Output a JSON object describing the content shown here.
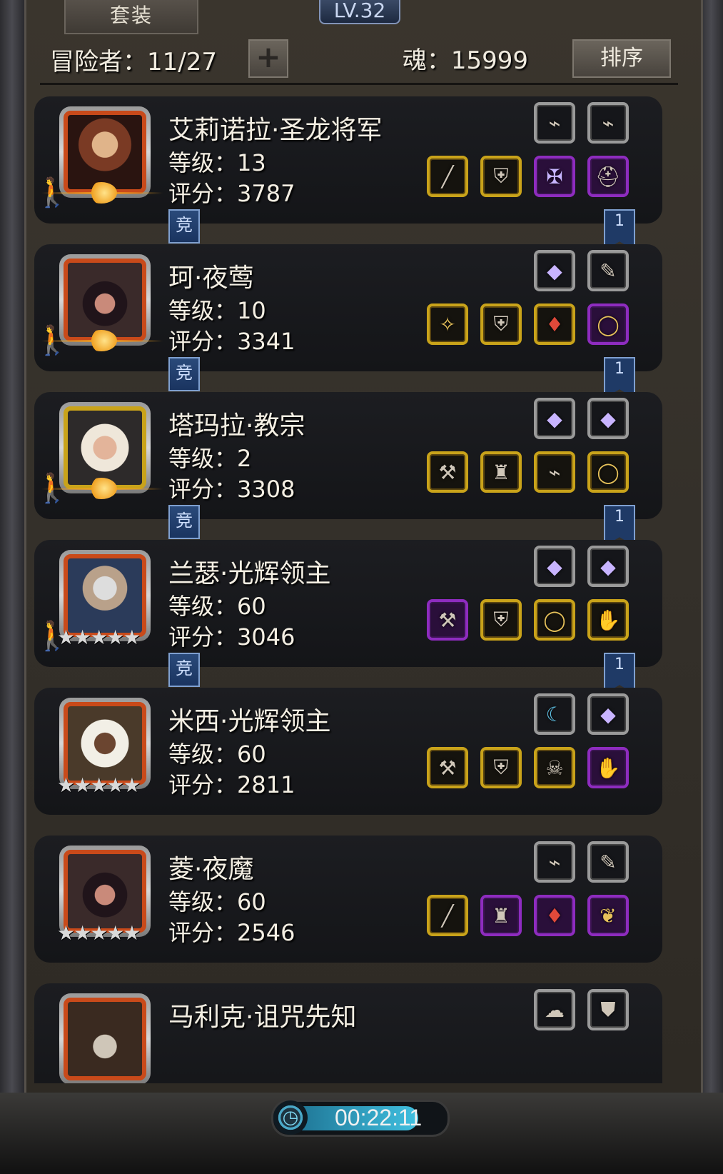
{
  "top_tab": "套装",
  "player_level": "LV.32",
  "header": {
    "adventurer_label": "冒险者：11/27",
    "add_symbol": "+",
    "soul_label": "魂：15999",
    "sort_label": "排序"
  },
  "compete_label": "竞",
  "ribbon_label": "1",
  "cards": [
    {
      "name": "艾莉诺拉·圣龙将军",
      "level": "等级：13",
      "score": "评分：3787",
      "badge": "moon",
      "has_compete": true,
      "has_ribbon": true,
      "top_slots": [
        {
          "frame": "gray",
          "icon": "bracer"
        },
        {
          "frame": "gray",
          "icon": "bracer"
        }
      ],
      "bottom_slots": [
        {
          "frame": "gold",
          "icon": "spear"
        },
        {
          "frame": "gold",
          "icon": "armor"
        },
        {
          "frame": "purple",
          "icon": "amulet"
        },
        {
          "frame": "purple",
          "icon": "helmet"
        }
      ]
    },
    {
      "name": "珂·夜莺",
      "level": "等级：10",
      "score": "评分：3341",
      "badge": "moon",
      "has_compete": true,
      "has_ribbon": true,
      "top_slots": [
        {
          "frame": "gray",
          "icon": "crystal"
        },
        {
          "frame": "gray",
          "icon": "feather"
        }
      ],
      "bottom_slots": [
        {
          "frame": "gold",
          "icon": "claw"
        },
        {
          "frame": "gold",
          "icon": "armor"
        },
        {
          "frame": "gold",
          "icon": "pendant"
        },
        {
          "frame": "purple",
          "icon": "ring"
        }
      ]
    },
    {
      "name": "塔玛拉·教宗",
      "level": "等级：2",
      "score": "评分：3308",
      "badge": "moon",
      "has_compete": true,
      "has_ribbon": true,
      "top_slots": [
        {
          "frame": "gray",
          "icon": "crystal"
        },
        {
          "frame": "gray",
          "icon": "crystal"
        }
      ],
      "bottom_slots": [
        {
          "frame": "gold",
          "icon": "hammer"
        },
        {
          "frame": "gold",
          "icon": "robe"
        },
        {
          "frame": "gold",
          "icon": "bracer"
        },
        {
          "frame": "gold",
          "icon": "ring"
        }
      ]
    },
    {
      "name": "兰瑟·光辉领主",
      "level": "等级：60",
      "score": "评分：3046",
      "badge": "stars",
      "has_compete": true,
      "has_ribbon": true,
      "top_slots": [
        {
          "frame": "gray",
          "icon": "crystal"
        },
        {
          "frame": "gray",
          "icon": "crystal"
        }
      ],
      "bottom_slots": [
        {
          "frame": "purple",
          "icon": "hammer"
        },
        {
          "frame": "gold",
          "icon": "armor"
        },
        {
          "frame": "gold",
          "icon": "ring"
        },
        {
          "frame": "gold",
          "icon": "gauntlet"
        }
      ]
    },
    {
      "name": "米西·光辉领主",
      "level": "等级：60",
      "score": "评分：2811",
      "badge": "stars",
      "has_compete": false,
      "has_ribbon": false,
      "top_slots": [
        {
          "frame": "gray",
          "icon": "bow"
        },
        {
          "frame": "gray",
          "icon": "crystal"
        }
      ],
      "bottom_slots": [
        {
          "frame": "gold",
          "icon": "hammer"
        },
        {
          "frame": "gold",
          "icon": "armor"
        },
        {
          "frame": "gold",
          "icon": "mask"
        },
        {
          "frame": "purple",
          "icon": "gauntlet"
        }
      ]
    },
    {
      "name": "菱·夜魔",
      "level": "等级：60",
      "score": "评分：2546",
      "badge": "stars",
      "has_compete": false,
      "has_ribbon": false,
      "top_slots": [
        {
          "frame": "gray",
          "icon": "bracer"
        },
        {
          "frame": "gray",
          "icon": "feather"
        }
      ],
      "bottom_slots": [
        {
          "frame": "gold",
          "icon": "spear"
        },
        {
          "frame": "purple",
          "icon": "robe"
        },
        {
          "frame": "purple",
          "icon": "pendant"
        },
        {
          "frame": "purple",
          "icon": "necklace"
        }
      ]
    },
    {
      "name": "马利克·诅咒先知",
      "level": "",
      "score": "",
      "badge": "none",
      "has_compete": false,
      "has_ribbon": false,
      "top_slots": [
        {
          "frame": "gray",
          "icon": "fur"
        },
        {
          "frame": "gray",
          "icon": "shield"
        }
      ],
      "bottom_slots": []
    }
  ],
  "stars": "★★★★★",
  "timer": {
    "text": "00:22:11",
    "progress": 0.85
  },
  "icon_glyphs": {
    "bracer": "⌁",
    "spear": "╱",
    "armor": "⛨",
    "amulet": "✠",
    "helmet": "⛑",
    "crystal": "◆",
    "feather": "✎",
    "claw": "✧",
    "pendant": "♦",
    "ring": "◯",
    "hammer": "⚒",
    "robe": "♜",
    "gauntlet": "✋",
    "bow": "☾",
    "mask": "☠",
    "necklace": "❦",
    "fur": "☁",
    "shield": "⛊"
  }
}
